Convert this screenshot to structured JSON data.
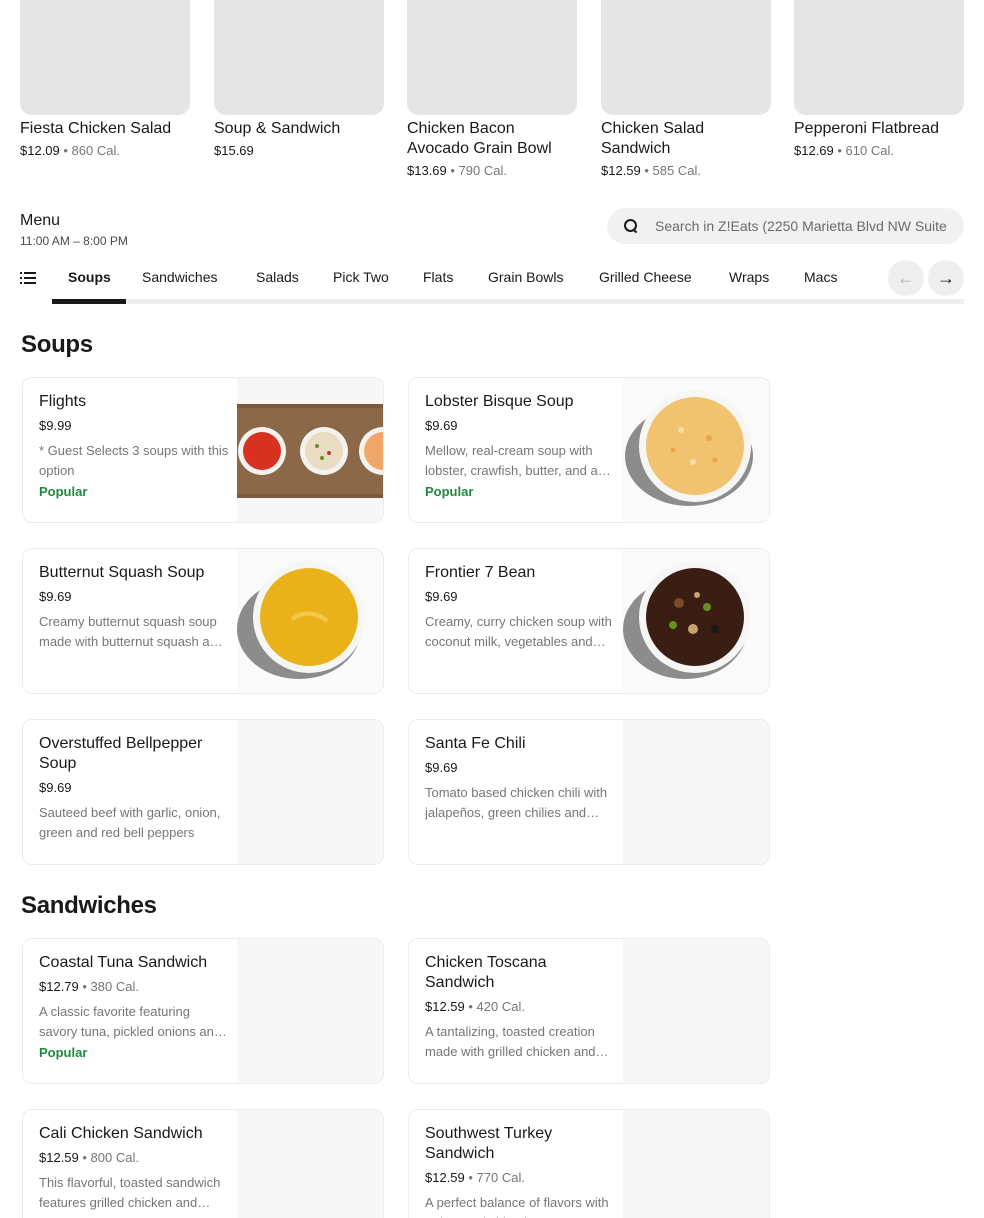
{
  "featured": [
    {
      "name": "Fiesta Chicken Salad",
      "price": "$12.09",
      "sep": " • ",
      "cal": "860 Cal."
    },
    {
      "name": "Soup & Sandwich",
      "price": "$15.69",
      "sep": "",
      "cal": ""
    },
    {
      "name": "Chicken Bacon Avocado Grain Bowl",
      "price": "$13.69",
      "sep": " • ",
      "cal": "790 Cal."
    },
    {
      "name": "Chicken Salad Sandwich",
      "price": "$12.59",
      "sep": " • ",
      "cal": "585 Cal."
    },
    {
      "name": "Pepperoni Flatbread",
      "price": "$12.69",
      "sep": " • ",
      "cal": "610 Cal."
    }
  ],
  "menu": {
    "title": "Menu",
    "hours": "11:00 AM – 8:00 PM"
  },
  "search": {
    "placeholder": "Search in Z!Eats (2250 Marietta Blvd NW Suite"
  },
  "tabs": [
    "Soups",
    "Sandwiches",
    "Salads",
    "Pick Two",
    "Flats",
    "Grain Bowls",
    "Grilled Cheese",
    "Wraps",
    "Macs"
  ],
  "nav": {
    "prev": "←",
    "next": "→"
  },
  "sections": [
    {
      "title": "Soups",
      "items": [
        {
          "name": "Flights",
          "price": "$9.99",
          "sep": "",
          "cal": "",
          "desc": "* Guest Selects 3 soups with this option",
          "badge": "Popular",
          "image": "soup-flight-icon"
        },
        {
          "name": "Lobster Bisque Soup",
          "price": "$9.69",
          "sep": "",
          "cal": "",
          "desc": "Mellow, real-cream soup with lobster, crawfish, butter, and a hint of sherry",
          "badge": "Popular",
          "image": "bisque-bowl-icon"
        },
        {
          "name": "Butternut Squash Soup",
          "price": "$9.69",
          "sep": "",
          "cal": "",
          "desc": "Creamy butternut squash soup made with butternut squash and spices",
          "badge": "",
          "image": "squash-bowl-icon"
        },
        {
          "name": "Frontier 7 Bean",
          "price": "$9.69",
          "sep": "",
          "cal": "",
          "desc": "Creamy, curry chicken soup with coconut milk, vegetables and beans",
          "badge": "",
          "image": "bean-bowl-icon"
        },
        {
          "name": "Overstuffed Bellpepper Soup",
          "price": "$9.69",
          "sep": "",
          "cal": "",
          "desc": "Sauteed beef with garlic, onion, green and red bell peppers",
          "badge": "",
          "image": ""
        },
        {
          "name": "Santa Fe Chili",
          "price": "$9.69",
          "sep": "",
          "cal": "",
          "desc": "Tomato based chicken chili with jalapeños, green chilies and beans",
          "badge": "",
          "image": ""
        }
      ]
    },
    {
      "title": "Sandwiches",
      "items": [
        {
          "name": "Coastal Tuna Sandwich",
          "price": "$12.79",
          "sep": " • ",
          "cal": "380 Cal.",
          "desc": "A classic favorite featuring savory tuna, pickled onions and greens",
          "badge": "Popular",
          "image": ""
        },
        {
          "name": "Chicken Toscana Sandwich",
          "price": "$12.59",
          "sep": " • ",
          "cal": "420 Cal.",
          "desc": "A tantalizing, toasted creation made with grilled chicken and pesto",
          "badge": "",
          "image": ""
        },
        {
          "name": "Cali Chicken Sandwich",
          "price": "$12.59",
          "sep": " • ",
          "cal": "800 Cal.",
          "desc": "This flavorful, toasted sandwich features grilled chicken and bacon",
          "badge": "",
          "image": ""
        },
        {
          "name": "Southwest Turkey Sandwich",
          "price": "$12.59",
          "sep": " • ",
          "cal": "770 Cal.",
          "desc": "A perfect balance of flavors with turkey and chipotle",
          "badge": "",
          "image": ""
        }
      ]
    }
  ]
}
